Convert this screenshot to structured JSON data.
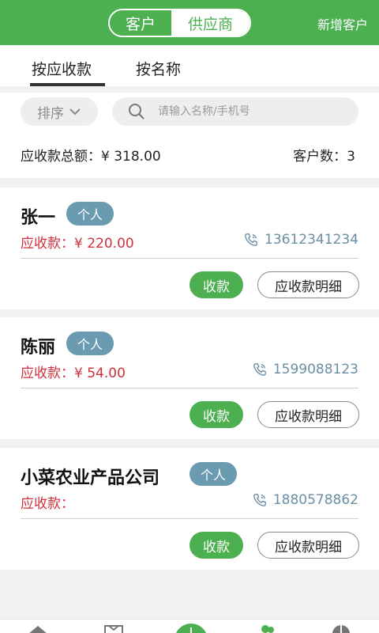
{
  "header": {
    "segments": [
      "客户",
      "供应商"
    ],
    "add_customer": "新增客户"
  },
  "tabs": [
    "按应收款",
    "按名称"
  ],
  "filters": {
    "sort_label": "排序",
    "search_placeholder": "请输入名称/手机号"
  },
  "summary": {
    "total": "应收款总额：¥ 318.00",
    "count": "客户数：3"
  },
  "customers": [
    {
      "name": "张一",
      "badge": "个人",
      "receivable": "应收款：¥ 220.00",
      "phone": "13612341234",
      "collect_label": "收款",
      "detail_label": "应收款明细"
    },
    {
      "name": "陈丽",
      "badge": "个人",
      "receivable": "应收款：¥ 54.00",
      "phone": "1599088123",
      "collect_label": "收款",
      "detail_label": "应收款明细"
    },
    {
      "name": "小菜农业产品公司",
      "badge": "个人",
      "receivable": "应收款：",
      "phone": "1880578862",
      "collect_label": "收款",
      "detail_label": "应收款明细"
    }
  ],
  "bottom_nav": [
    "home-icon",
    "box-icon",
    "plus-icon",
    "users-icon",
    "pie-chart-icon"
  ],
  "colors": {
    "primary": "#4caf50",
    "badge": "#6a9bb0",
    "receivable_red": "#d0303a",
    "phone_blue": "#6a8ea3"
  }
}
